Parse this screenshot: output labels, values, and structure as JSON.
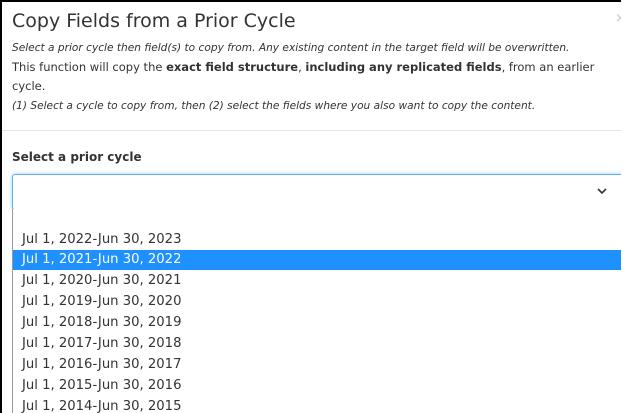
{
  "modal": {
    "title": "Copy Fields from a Prior Cycle",
    "close_glyph": "×",
    "instructions": {
      "line1": "Select a prior cycle then field(s) to copy from. Any existing content in the target field will be overwritten.",
      "line2_a": "This function will copy the ",
      "line2_b": "exact field structure",
      "line2_c": ", ",
      "line2_d": "including any replicated fields",
      "line2_e": ", from an earlier",
      "line3": "cycle.",
      "line4": "(1) Select a cycle to copy from, then (2) select the fields where you also want to copy the content."
    }
  },
  "cycle_select": {
    "label": "Select a prior cycle",
    "value": "",
    "chevron_icon": "chevron-down-icon",
    "options": [
      "Jul 1, 2022-Jun 30, 2023",
      "Jul 1, 2021-Jun 30, 2022",
      "Jul 1, 2020-Jun 30, 2021",
      "Jul 1, 2019-Jun 30, 2020",
      "Jul 1, 2018-Jun 30, 2019",
      "Jul 1, 2017-Jun 30, 2018",
      "Jul 1, 2016-Jun 30, 2017",
      "Jul 1, 2015-Jun 30, 2016",
      "Jul 1, 2014-Jun 30, 2015"
    ],
    "highlighted_option": "Jul 1, 2021-Jun 30, 2022"
  },
  "colors": {
    "highlight": "#1e90ff",
    "focus_border": "#66afe9",
    "text": "#333333"
  }
}
